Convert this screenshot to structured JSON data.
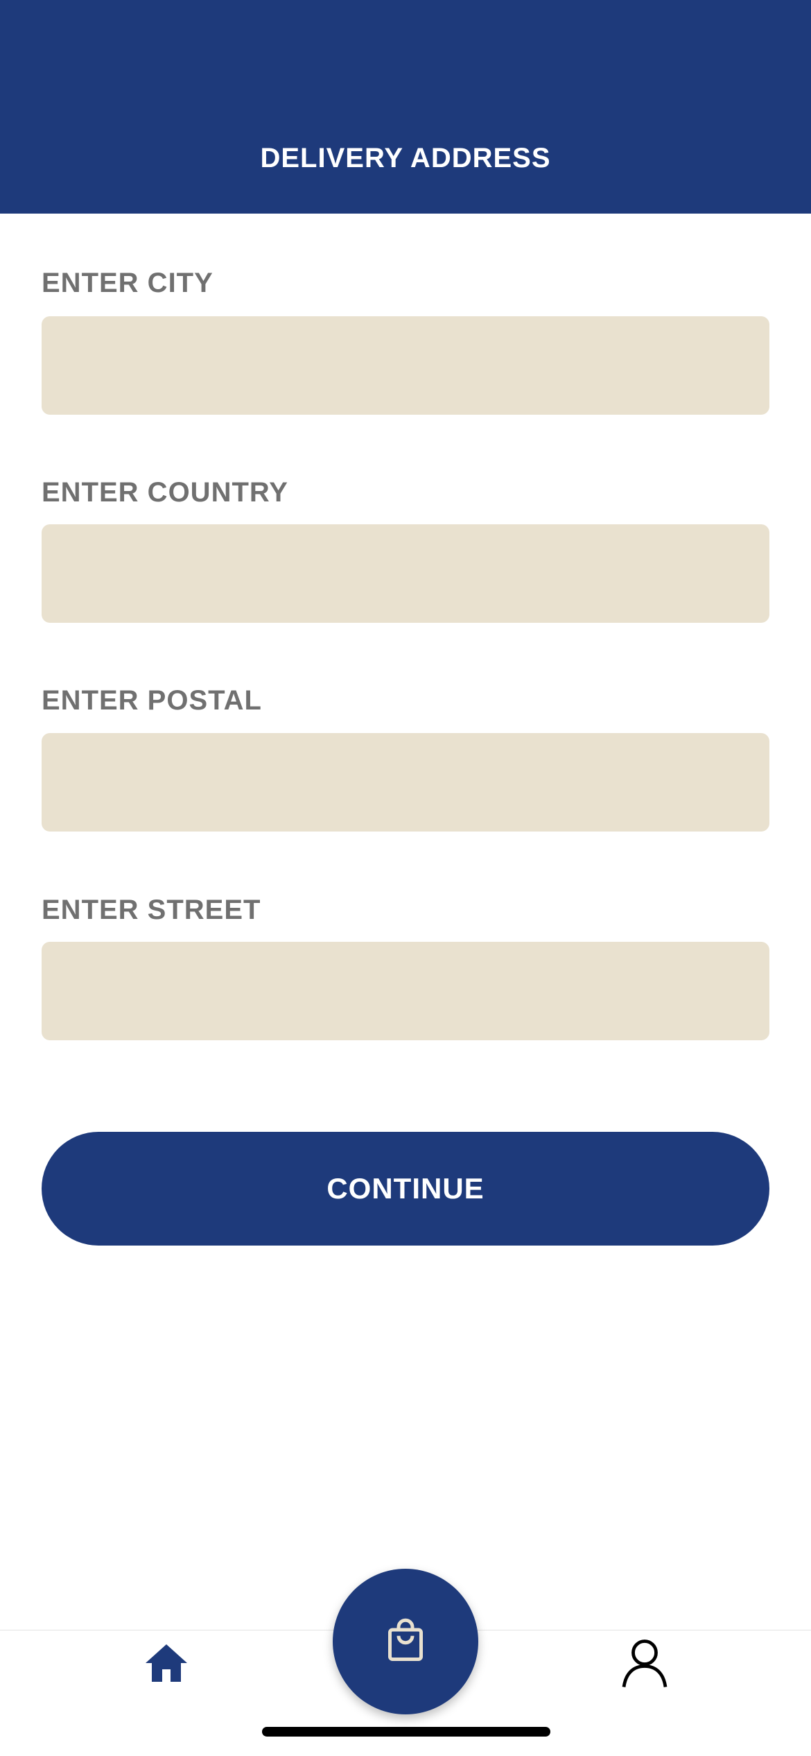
{
  "header": {
    "title": "DELIVERY ADDRESS"
  },
  "form": {
    "fields": [
      {
        "label": "ENTER CITY",
        "value": "",
        "placeholder": ""
      },
      {
        "label": "ENTER COUNTRY",
        "value": "",
        "placeholder": ""
      },
      {
        "label": "ENTER POSTAL",
        "value": "",
        "placeholder": ""
      },
      {
        "label": "ENTER STREET",
        "value": "",
        "placeholder": ""
      }
    ],
    "continue_label": "CONTINUE"
  },
  "tabbar": {
    "items": [
      {
        "icon": "home-icon",
        "active": true
      },
      {
        "icon": "shopping-bag-icon",
        "active": false
      },
      {
        "icon": "user-icon",
        "active": false
      }
    ]
  },
  "colors": {
    "primary": "#1e3a7b",
    "input_bg": "#e9e1cf",
    "label_text": "#707070"
  }
}
